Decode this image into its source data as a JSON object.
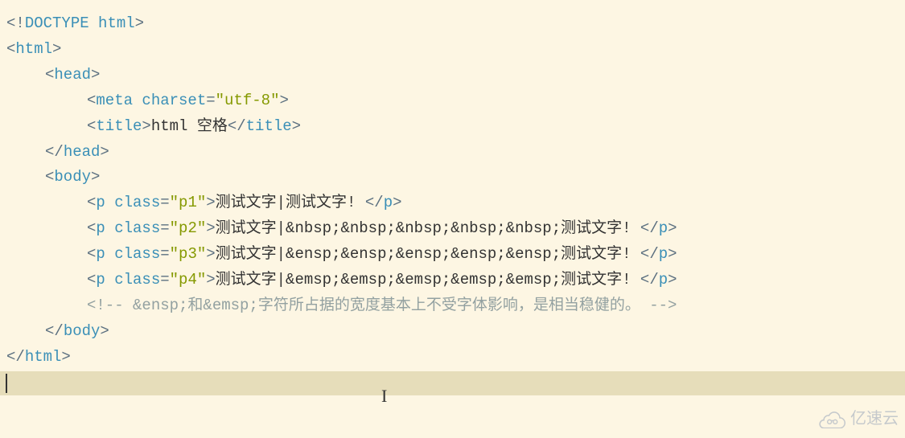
{
  "code": {
    "lines": [
      {
        "indent": 0,
        "tokens": [
          {
            "cls": "punct",
            "t": "<!"
          },
          {
            "cls": "tag",
            "t": "DOCTYPE"
          },
          {
            "cls": "text",
            "t": " "
          },
          {
            "cls": "attr-name",
            "t": "html"
          },
          {
            "cls": "punct",
            "t": ">"
          }
        ]
      },
      {
        "indent": 0,
        "tokens": [
          {
            "cls": "punct",
            "t": "<"
          },
          {
            "cls": "tag",
            "t": "html"
          },
          {
            "cls": "punct",
            "t": ">"
          }
        ]
      },
      {
        "indent": 1,
        "tokens": [
          {
            "cls": "punct",
            "t": "<"
          },
          {
            "cls": "tag",
            "t": "head"
          },
          {
            "cls": "punct",
            "t": ">"
          }
        ]
      },
      {
        "indent": 2,
        "tokens": [
          {
            "cls": "punct",
            "t": "<"
          },
          {
            "cls": "tag",
            "t": "meta"
          },
          {
            "cls": "text",
            "t": " "
          },
          {
            "cls": "attr-name",
            "t": "charset"
          },
          {
            "cls": "punct",
            "t": "="
          },
          {
            "cls": "attr-val",
            "t": "\"utf-8\""
          },
          {
            "cls": "punct",
            "t": ">"
          }
        ]
      },
      {
        "indent": 2,
        "tokens": [
          {
            "cls": "punct",
            "t": "<"
          },
          {
            "cls": "tag",
            "t": "title"
          },
          {
            "cls": "punct",
            "t": ">"
          },
          {
            "cls": "text",
            "t": "html 空格"
          },
          {
            "cls": "punct",
            "t": "</"
          },
          {
            "cls": "tag",
            "t": "title"
          },
          {
            "cls": "punct",
            "t": ">"
          }
        ]
      },
      {
        "indent": 1,
        "tokens": [
          {
            "cls": "punct",
            "t": "</"
          },
          {
            "cls": "tag",
            "t": "head"
          },
          {
            "cls": "punct",
            "t": ">"
          }
        ]
      },
      {
        "indent": 1,
        "tokens": [
          {
            "cls": "punct",
            "t": "<"
          },
          {
            "cls": "tag",
            "t": "body"
          },
          {
            "cls": "punct",
            "t": ">"
          }
        ]
      },
      {
        "indent": 2,
        "tokens": [
          {
            "cls": "punct",
            "t": "<"
          },
          {
            "cls": "tag",
            "t": "p"
          },
          {
            "cls": "text",
            "t": " "
          },
          {
            "cls": "attr-name",
            "t": "class"
          },
          {
            "cls": "punct",
            "t": "="
          },
          {
            "cls": "attr-val",
            "t": "\"p1\""
          },
          {
            "cls": "punct",
            "t": ">"
          },
          {
            "cls": "text",
            "t": "测试文字|测试文字! "
          },
          {
            "cls": "punct",
            "t": "</"
          },
          {
            "cls": "tag",
            "t": "p"
          },
          {
            "cls": "punct",
            "t": ">"
          }
        ]
      },
      {
        "indent": 2,
        "tokens": [
          {
            "cls": "punct",
            "t": "<"
          },
          {
            "cls": "tag",
            "t": "p"
          },
          {
            "cls": "text",
            "t": " "
          },
          {
            "cls": "attr-name",
            "t": "class"
          },
          {
            "cls": "punct",
            "t": "="
          },
          {
            "cls": "attr-val",
            "t": "\"p2\""
          },
          {
            "cls": "punct",
            "t": ">"
          },
          {
            "cls": "text",
            "t": "测试文字|&nbsp;&nbsp;&nbsp;&nbsp;&nbsp;测试文字! "
          },
          {
            "cls": "punct",
            "t": "</"
          },
          {
            "cls": "tag",
            "t": "p"
          },
          {
            "cls": "punct",
            "t": ">"
          }
        ]
      },
      {
        "indent": 2,
        "tokens": [
          {
            "cls": "punct",
            "t": "<"
          },
          {
            "cls": "tag",
            "t": "p"
          },
          {
            "cls": "text",
            "t": " "
          },
          {
            "cls": "attr-name",
            "t": "class"
          },
          {
            "cls": "punct",
            "t": "="
          },
          {
            "cls": "attr-val",
            "t": "\"p3\""
          },
          {
            "cls": "punct",
            "t": ">"
          },
          {
            "cls": "text",
            "t": "测试文字|&ensp;&ensp;&ensp;&ensp;&ensp;测试文字! "
          },
          {
            "cls": "punct",
            "t": "</"
          },
          {
            "cls": "tag",
            "t": "p"
          },
          {
            "cls": "punct",
            "t": ">"
          }
        ]
      },
      {
        "indent": 2,
        "tokens": [
          {
            "cls": "punct",
            "t": "<"
          },
          {
            "cls": "tag",
            "t": "p"
          },
          {
            "cls": "text",
            "t": " "
          },
          {
            "cls": "attr-name",
            "t": "class"
          },
          {
            "cls": "punct",
            "t": "="
          },
          {
            "cls": "attr-val",
            "t": "\"p4\""
          },
          {
            "cls": "punct",
            "t": ">"
          },
          {
            "cls": "text",
            "t": "测试文字|&emsp;&emsp;&emsp;&emsp;&emsp;测试文字! "
          },
          {
            "cls": "punct",
            "t": "</"
          },
          {
            "cls": "tag",
            "t": "p"
          },
          {
            "cls": "punct",
            "t": ">"
          }
        ]
      },
      {
        "indent": 2,
        "tokens": [
          {
            "cls": "comment",
            "t": "<!-- &ensp;和&emsp;字符所占据的宽度基本上不受字体影响，是相当稳健的。 -->"
          }
        ]
      },
      {
        "indent": 1,
        "tokens": [
          {
            "cls": "punct",
            "t": "</"
          },
          {
            "cls": "tag",
            "t": "body"
          },
          {
            "cls": "punct",
            "t": ">"
          }
        ]
      },
      {
        "indent": 0,
        "tokens": [
          {
            "cls": "punct",
            "t": "</"
          },
          {
            "cls": "tag",
            "t": "html"
          },
          {
            "cls": "punct",
            "t": ">"
          }
        ]
      }
    ]
  },
  "watermark": {
    "text": "亿速云"
  }
}
